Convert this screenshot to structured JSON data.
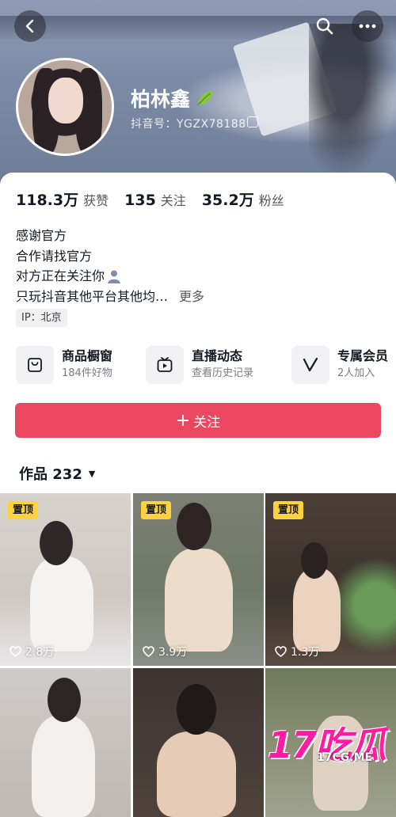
{
  "profile": {
    "name": "柏林鑫",
    "account_label": "抖音号：YGZX78188"
  },
  "stats": [
    {
      "value": "118.3万",
      "label": "获赞"
    },
    {
      "value": "135",
      "label": "关注"
    },
    {
      "value": "35.2万",
      "label": "粉丝"
    }
  ],
  "bio": {
    "lines": [
      "感谢官方",
      "合作请找官方",
      "对方正在关注你",
      "只玩抖音其他平台其他均…"
    ],
    "more": "更多",
    "ip": "IP：北京"
  },
  "features": [
    {
      "title": "商品橱窗",
      "subtitle": "184件好物",
      "icon": "shopping-bag-icon"
    },
    {
      "title": "直播动态",
      "subtitle": "查看历史记录",
      "icon": "tv-icon"
    },
    {
      "title": "专属会员",
      "subtitle": "2人加入",
      "icon": "v-badge-icon"
    }
  ],
  "follow_button": {
    "label": "关注",
    "color": "#ea4860"
  },
  "works_tab": {
    "label": "作品 232"
  },
  "videos": [
    {
      "pinned": "置顶",
      "likes": "2.8万"
    },
    {
      "pinned": "置顶",
      "likes": "3.9万"
    },
    {
      "pinned": "置顶",
      "likes": "1.3万"
    },
    {
      "pinned": "",
      "likes": ""
    },
    {
      "pinned": "",
      "likes": ""
    },
    {
      "pinned": "",
      "likes": ""
    }
  ],
  "watermark": {
    "big": "17吃瓜",
    "small": "17CG.ME"
  },
  "colors": {
    "accent": "#ea4860",
    "pin": "#fdd23c",
    "watermark": "#ff1ca3"
  }
}
